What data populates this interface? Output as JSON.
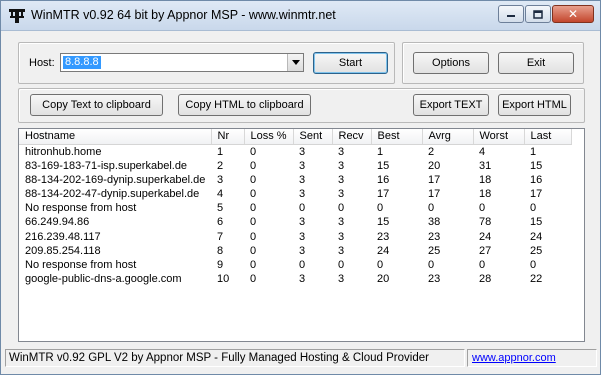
{
  "window": {
    "title": "WinMTR v0.92 64 bit by Appnor MSP - www.winmtr.net",
    "minimize_icon": "minimize-icon",
    "maximize_icon": "maximize-icon",
    "close_icon": "close-icon"
  },
  "host": {
    "label": "Host:",
    "value": "8.8.8.8"
  },
  "buttons": {
    "start": "Start",
    "options": "Options",
    "exit": "Exit",
    "copy_text": "Copy Text to clipboard",
    "copy_html": "Copy HTML to clipboard",
    "export_text": "Export TEXT",
    "export_html": "Export HTML"
  },
  "results": {
    "columns": [
      "Hostname",
      "Nr",
      "Loss %",
      "Sent",
      "Recv",
      "Best",
      "Avrg",
      "Worst",
      "Last"
    ],
    "rows": [
      [
        "hitronhub.home",
        "1",
        "0",
        "3",
        "3",
        "1",
        "2",
        "4",
        "1"
      ],
      [
        "83-169-183-71-isp.superkabel.de",
        "2",
        "0",
        "3",
        "3",
        "15",
        "20",
        "31",
        "15"
      ],
      [
        "88-134-202-169-dynip.superkabel.de",
        "3",
        "0",
        "3",
        "3",
        "16",
        "17",
        "18",
        "16"
      ],
      [
        "88-134-202-47-dynip.superkabel.de",
        "4",
        "0",
        "3",
        "3",
        "17",
        "17",
        "18",
        "17"
      ],
      [
        "No response from host",
        "5",
        "0",
        "0",
        "0",
        "0",
        "0",
        "0",
        "0"
      ],
      [
        "66.249.94.86",
        "6",
        "0",
        "3",
        "3",
        "15",
        "38",
        "78",
        "15"
      ],
      [
        "216.239.48.117",
        "7",
        "0",
        "3",
        "3",
        "23",
        "23",
        "24",
        "24"
      ],
      [
        "209.85.254.118",
        "8",
        "0",
        "3",
        "3",
        "24",
        "25",
        "27",
        "25"
      ],
      [
        "No response from host",
        "9",
        "0",
        "0",
        "0",
        "0",
        "0",
        "0",
        "0"
      ],
      [
        "google-public-dns-a.google.com",
        "10",
        "0",
        "3",
        "3",
        "20",
        "23",
        "28",
        "22"
      ]
    ]
  },
  "status": {
    "text": "WinMTR v0.92 GPL V2 by Appnor MSP - Fully Managed Hosting & Cloud Provider",
    "link": "www.appnor.com"
  },
  "colors": {
    "selection": "#3399ff",
    "link": "#0000ff"
  }
}
